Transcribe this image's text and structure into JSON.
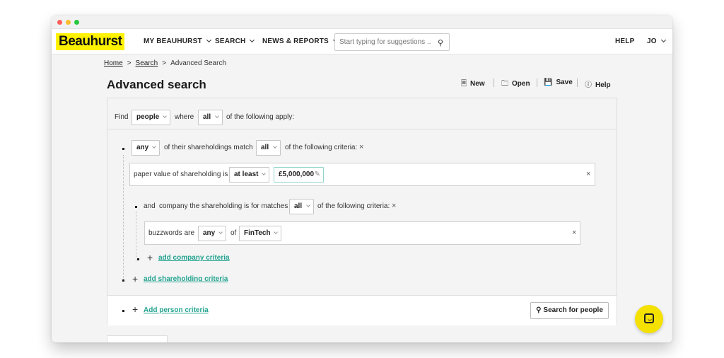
{
  "nav": {
    "logo": "Beauhurst",
    "my": "MY BEAUHURST",
    "search": "SEARCH",
    "news": "NEWS & REPORTS",
    "search_placeholder": "Start typing for suggestions ...",
    "help": "HELP",
    "user": "JO"
  },
  "breadcrumb": {
    "home": "Home",
    "search": "Search",
    "current": "Advanced Search",
    "sep": ">"
  },
  "page": {
    "title": "Advanced search"
  },
  "toolbar": {
    "new": "New",
    "open": "Open",
    "save": "Save",
    "help": "Help"
  },
  "find": {
    "find": "Find",
    "entity": "people",
    "where": "where",
    "quant": "all",
    "apply": "of the following apply:"
  },
  "shareholding": {
    "quant": "any",
    "match": "of their shareholdings match",
    "crit_quant": "all",
    "crit": "of the following criteria:"
  },
  "value_row": {
    "label": "paper value of shareholding is",
    "op": "at least",
    "amount": "£5,000,000"
  },
  "company": {
    "and": "and",
    "label": "company the shareholding is for matches",
    "quant": "all",
    "crit": "of the following criteria:"
  },
  "buzz_row": {
    "label": "buzzwords are",
    "quant": "any",
    "of": "of",
    "value": "FinTech"
  },
  "links": {
    "company": "add company criteria",
    "shareholding": "add shareholding criteria",
    "person": "Add person criteria"
  },
  "actions": {
    "search": "Search for people"
  },
  "colors": {
    "brand": "#fff200",
    "link": "#23a38f"
  }
}
